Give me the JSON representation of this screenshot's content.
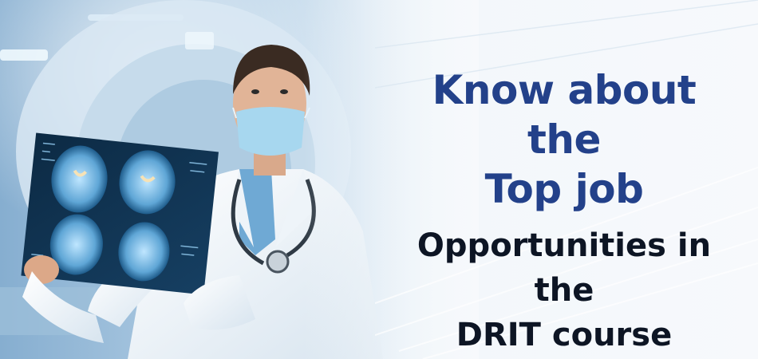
{
  "banner": {
    "headline_line1": "Know about the",
    "headline_line2": "Top job",
    "headline_line3": "Opportunities in the",
    "headline_line4": "DRIT course",
    "colors": {
      "headline_blue": "#23418a",
      "headline_dark": "#0d1524",
      "background": "#f3f7fb"
    },
    "photo_subject": "doctor-holding-brain-mri-scan"
  }
}
